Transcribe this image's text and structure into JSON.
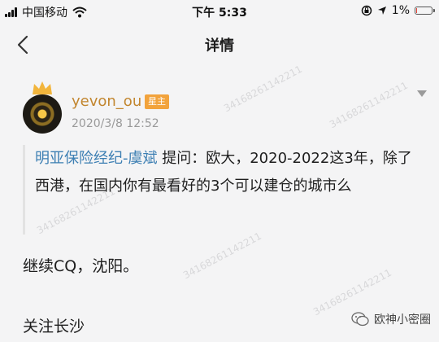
{
  "status_bar": {
    "carrier": "中国移动",
    "time": "下午 5:33",
    "battery_percent": "1%",
    "battery_level": 0.01,
    "icons": [
      "signal-icon",
      "wifi-icon",
      "rotation-lock-icon",
      "location-icon",
      "battery-icon"
    ]
  },
  "nav": {
    "title": "详情",
    "back_icon": "chevron-left-icon"
  },
  "post": {
    "username": "yevon_ou",
    "badge": "星主",
    "timestamp": "2020/3/8 12:52",
    "more_icon": "chevron-down-icon",
    "quote_author": "明亚保险经纪-虞斌",
    "quote_text": " 提问：欧大，2020-2022这3年，除了西港，在国内你有最看好的3个可以建仓的城市么",
    "answer": "继续CQ，沈阳。",
    "reply": "关注长沙",
    "watermark": "34168261142211"
  },
  "wechat_mark": {
    "label": "欧神小密圈",
    "icon": "wechat-icon"
  },
  "colors": {
    "username": "#c2862f",
    "badge": "#f2a33c",
    "quote_author": "#3d7fb3",
    "battery": "#e03a2e",
    "background": "#f4f4f5"
  }
}
